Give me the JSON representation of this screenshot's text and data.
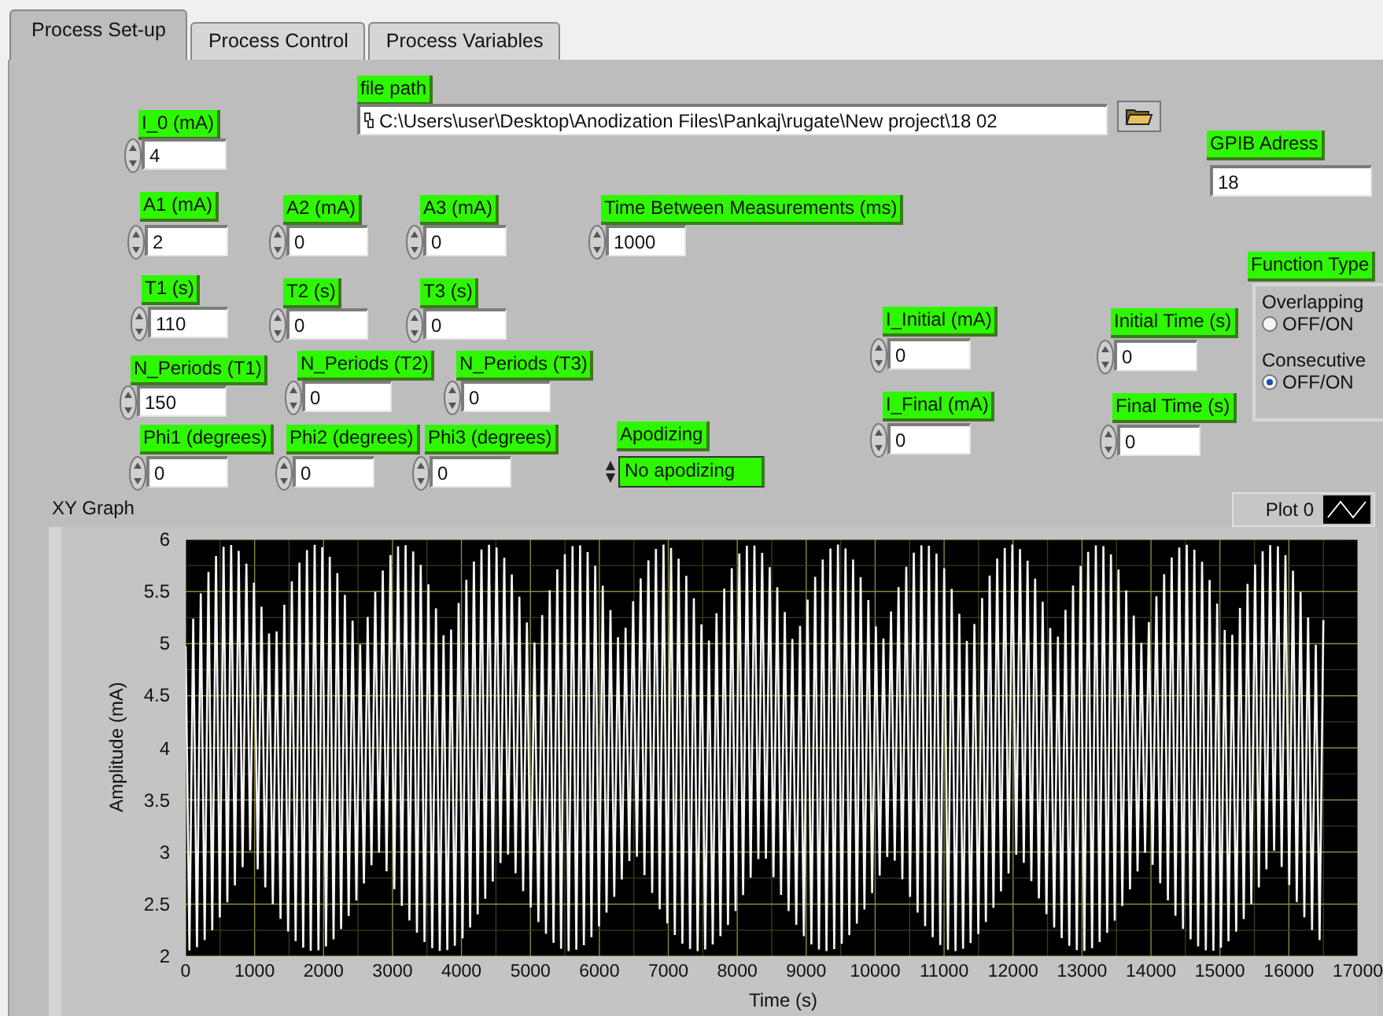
{
  "tabs": [
    {
      "label": "Process Set-up",
      "selected": true
    },
    {
      "label": "Process Control",
      "selected": false
    },
    {
      "label": "Process Variables",
      "selected": false
    }
  ],
  "controls": [
    {
      "kind": "path",
      "label": "file path",
      "value": "C:\\Users\\user\\Desktop\\Anodization Files\\Pankaj\\rugate\\New project\\18 02"
    },
    {
      "kind": "numeric",
      "label": "I_0 (mA)",
      "value": "4"
    },
    {
      "kind": "string",
      "label": "GPIB Adress",
      "value": "18"
    },
    {
      "kind": "numeric",
      "label": "A1 (mA)",
      "value": "2"
    },
    {
      "kind": "numeric",
      "label": "A2 (mA)",
      "value": "0"
    },
    {
      "kind": "numeric",
      "label": "A3 (mA)",
      "value": "0"
    },
    {
      "kind": "numeric",
      "label": "Time Between Measurements (ms)",
      "value": "1000"
    },
    {
      "kind": "numeric",
      "label": "T1 (s)",
      "value": "110"
    },
    {
      "kind": "numeric",
      "label": "T2 (s)",
      "value": "0"
    },
    {
      "kind": "numeric",
      "label": "T3 (s)",
      "value": "0"
    },
    {
      "kind": "radio_group",
      "label": "Function Type",
      "options": [
        {
          "label": "Overlapping",
          "caption": "OFF/ON",
          "selected": false
        },
        {
          "label": "Consecutive",
          "caption": "OFF/ON",
          "selected": true
        }
      ]
    },
    {
      "kind": "numeric",
      "label": "I_Initial (mA)",
      "value": "0"
    },
    {
      "kind": "numeric",
      "label": "Initial Time (s)",
      "value": "0"
    },
    {
      "kind": "numeric",
      "label": "N_Periods (T1)",
      "value": "150"
    },
    {
      "kind": "numeric",
      "label": "N_Periods (T2)",
      "value": "0"
    },
    {
      "kind": "numeric",
      "label": "N_Periods (T3)",
      "value": "0"
    },
    {
      "kind": "numeric",
      "label": "I_Final (mA)",
      "value": "0"
    },
    {
      "kind": "numeric",
      "label": "Final Time (s)",
      "value": "0"
    },
    {
      "kind": "numeric",
      "label": "Phi1 (degrees)",
      "value": "0"
    },
    {
      "kind": "numeric",
      "label": "Phi2 (degrees)",
      "value": "0"
    },
    {
      "kind": "numeric",
      "label": "Phi3 (degrees)",
      "value": "0"
    },
    {
      "kind": "enum",
      "label": "Apodizing",
      "value": "No apodizing"
    }
  ],
  "graph": {
    "title": "XY Graph",
    "legend": "Plot 0",
    "xlabel": "Time (s)",
    "ylabel": "Amplitude (mA)",
    "xticks": [
      "0",
      "1000",
      "2000",
      "3000",
      "4000",
      "5000",
      "6000",
      "7000",
      "8000",
      "9000",
      "10000",
      "11000",
      "12000",
      "13000",
      "14000",
      "15000",
      "16000",
      "17000"
    ],
    "yticks": [
      "6",
      "5.5",
      "5",
      "4.5",
      "4",
      "3.5",
      "3",
      "2.5",
      "2"
    ]
  }
}
